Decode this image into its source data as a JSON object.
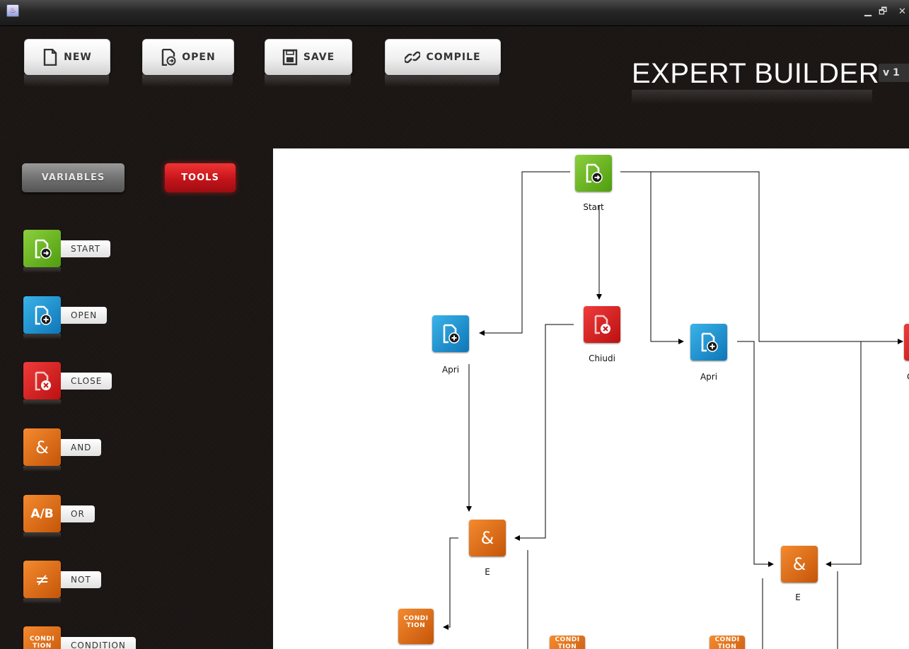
{
  "window": {
    "minimize_glyph": "▁",
    "maximize_glyph": "🗗",
    "close_glyph": "✕"
  },
  "toolbar": {
    "new_label": "NEW",
    "open_label": "OPEN",
    "save_label": "SAVE",
    "compile_label": "COMPILE"
  },
  "brand": {
    "title": "EXPERT BUILDER",
    "version": "v 1"
  },
  "panel": {
    "tabs": [
      "VARIABLES",
      "TOOLS"
    ],
    "active_tab": "TOOLS",
    "tools": [
      {
        "label": "START",
        "icon": "file-start-icon",
        "color": "green"
      },
      {
        "label": "OPEN",
        "icon": "file-add-icon",
        "color": "blue"
      },
      {
        "label": "CLOSE",
        "icon": "file-close-icon",
        "color": "red"
      },
      {
        "label": "AND",
        "icon": "ampersand-icon",
        "glyph": "&",
        "color": "orange"
      },
      {
        "label": "OR",
        "icon": "or-icon",
        "glyph": "A/B",
        "color": "orange"
      },
      {
        "label": "NOT",
        "icon": "not-equal-icon",
        "glyph": "≠",
        "color": "orange"
      },
      {
        "label": "CONDITION",
        "icon": "condition-icon",
        "glyph": "CONDI\nTION",
        "color": "orange"
      }
    ]
  },
  "diagram": {
    "nodes": [
      {
        "id": "start",
        "kind": "start",
        "label": "Start"
      },
      {
        "id": "apri1",
        "kind": "open",
        "label": "Apri"
      },
      {
        "id": "chiudi1",
        "kind": "close",
        "label": "Chiudi"
      },
      {
        "id": "apri2",
        "kind": "open",
        "label": "Apri"
      },
      {
        "id": "close2",
        "kind": "close",
        "label": "C"
      },
      {
        "id": "e1",
        "kind": "and",
        "label": "E",
        "glyph": "&"
      },
      {
        "id": "e2",
        "kind": "and",
        "label": "E",
        "glyph": "&"
      },
      {
        "id": "cond1",
        "kind": "condition",
        "glyph_line1": "CONDI",
        "glyph_line2": "TION"
      },
      {
        "id": "cond2",
        "kind": "condition",
        "glyph_line1": "CONDI",
        "glyph_line2": "TION"
      },
      {
        "id": "cond3",
        "kind": "condition",
        "glyph_line1": "CONDI",
        "glyph_line2": "TION"
      }
    ]
  },
  "colors": {
    "background": "#1c1715",
    "green": "#6bb325",
    "blue": "#1a8fd0",
    "red": "#dd2222",
    "orange": "#e26f18",
    "canvas": "#ffffff"
  }
}
